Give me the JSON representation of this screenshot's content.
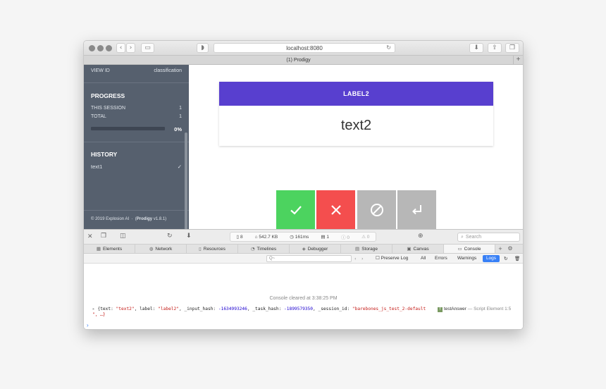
{
  "browser": {
    "address": "localhost:8080",
    "tab_title": "(1) Prodigy",
    "tab_add": "+"
  },
  "sidebar": {
    "view_id_label": "VIEW ID",
    "view_id_value": "classification",
    "progress_heading": "PROGRESS",
    "this_session_label": "THIS SESSION",
    "this_session_value": "1",
    "total_label": "TOTAL",
    "total_value": "1",
    "progress_fraction": 0,
    "progress_percent": "0%",
    "history_heading": "HISTORY",
    "history_items": [
      {
        "text": "text1",
        "status": "accept"
      }
    ],
    "footer_copyright": "© 2019 Explosion AI",
    "footer_app": "Prodigy",
    "footer_version": "v1.8.1"
  },
  "task": {
    "label": "LABEL2",
    "text": "text2"
  },
  "actions": [
    {
      "name": "accept",
      "color": "#4cd35f"
    },
    {
      "name": "reject",
      "color": "#f44e4e"
    },
    {
      "name": "ignore",
      "color": "#b7b7b7"
    },
    {
      "name": "undo",
      "color": "#b7b7b7"
    }
  ],
  "devtools": {
    "resources": "8",
    "size": "542.7 KB",
    "time": "161ms",
    "logs": "1",
    "errors": "0",
    "warnings": "0",
    "search_placeholder": "Search",
    "tabs": [
      "Elements",
      "Network",
      "Resources",
      "Timelines",
      "Debugger",
      "Storage",
      "Canvas",
      "Console"
    ],
    "active_tab": "Console",
    "filter_placeholder": "Q~",
    "preserve_log": "Preserve Log",
    "filters": [
      "All",
      "Errors",
      "Warnings",
      "Logs"
    ],
    "active_filter": "Logs",
    "cleared_message": "Console cleared at 3:38:25 PM",
    "log": {
      "text_key": "text",
      "text_value": "\"text2\"",
      "label_key": "label",
      "label_value": "\"label2\"",
      "input_hash_key": "_input_hash",
      "input_hash_value": "-1634993246",
      "task_hash_key": "_task_hash",
      "task_hash_value": "-1899579350",
      "session_key": "_session_id",
      "session_value": "\"barebones_js_test_2-default",
      "continuation": "\", …}",
      "source_fn": "testAnswer",
      "source_loc": "— Script Element 1:5"
    },
    "prompt": "›"
  },
  "colors": {
    "sidebar_bg": "#56606e",
    "label_bar": "#583fcf",
    "accept": "#4cd35f",
    "reject": "#f44e4e",
    "neutral": "#b7b7b7",
    "logs_active": "#3880f6"
  }
}
